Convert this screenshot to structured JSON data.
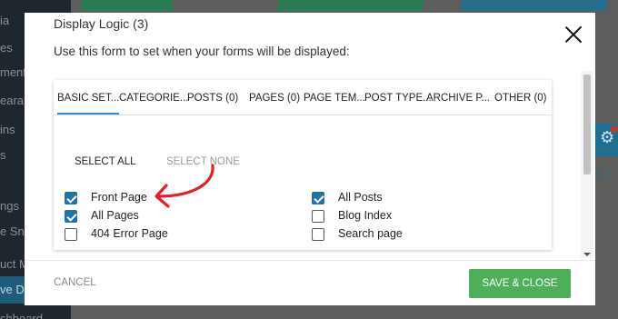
{
  "background": {
    "sidebar_items": [
      "ia",
      "es",
      "ments",
      "earan",
      "ins",
      "s",
      "ngs",
      "e Snip",
      "uct M",
      "ve Da",
      "shboard"
    ],
    "active_index": 9,
    "colors": {
      "sidebar": "#1f272e",
      "active": "#1e5c7c",
      "accent_blue": "#1e6f92",
      "badge": "#c0392b"
    }
  },
  "modal": {
    "title": "Display Logic (3)",
    "description": "Use this form to set when your forms will be displayed:",
    "tabs": [
      {
        "label": "BASIC SET...",
        "active": true
      },
      {
        "label": "CATEGORIE..."
      },
      {
        "label": "POSTS (0)"
      },
      {
        "label": "PAGES (0)"
      },
      {
        "label": "PAGE TEM..."
      },
      {
        "label": "POST TYPE..."
      },
      {
        "label": "ARCHIVE P..."
      },
      {
        "label": "OTHER (0)"
      }
    ],
    "select_all": "SELECT ALL",
    "select_none": "SELECT NONE",
    "checkboxes_left": [
      {
        "label": "Front Page",
        "checked": true
      },
      {
        "label": "All Pages",
        "checked": true
      },
      {
        "label": "404 Error Page",
        "checked": false
      }
    ],
    "checkboxes_right": [
      {
        "label": "All Posts",
        "checked": true
      },
      {
        "label": "Blog Index",
        "checked": false
      },
      {
        "label": "Search page",
        "checked": false
      }
    ],
    "cancel_label": "CANCEL",
    "save_label": "SAVE & CLOSE",
    "colors": {
      "accent": "#2e8ecb",
      "checkbox": "#2273a8",
      "save": "#4fae5a",
      "annotation_arrow": "#e0202a"
    }
  }
}
